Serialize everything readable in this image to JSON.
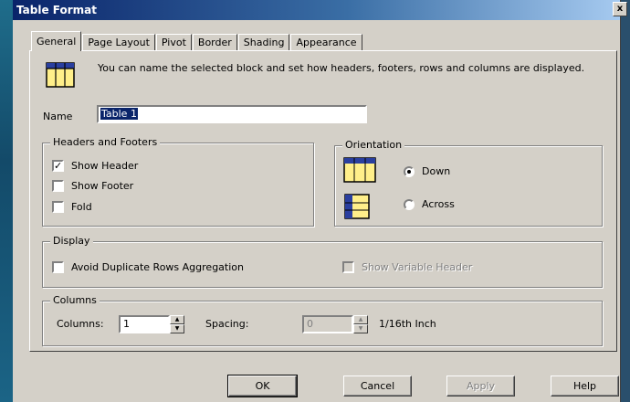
{
  "window": {
    "title": "Table Format",
    "close_glyph": "x"
  },
  "tabs": [
    "General",
    "Page Layout",
    "Pivot",
    "Border",
    "Shading",
    "Appearance"
  ],
  "active_tab": "General",
  "info": {
    "icon": "table-icon",
    "text": "You can name the selected block and set how headers, footers, rows and columns are displayed."
  },
  "name": {
    "label": "Name",
    "value": "Table 1"
  },
  "headers_footers": {
    "legend": "Headers and Footers",
    "show_header": {
      "label": "Show Header",
      "checked": true
    },
    "show_footer": {
      "label": "Show Footer",
      "checked": false
    },
    "fold": {
      "label": "Fold",
      "checked": false
    }
  },
  "orientation": {
    "legend": "Orientation",
    "down": {
      "label": "Down",
      "selected": true,
      "icon": "orientation-down-icon"
    },
    "across": {
      "label": "Across",
      "selected": false,
      "icon": "orientation-across-icon"
    }
  },
  "display": {
    "legend": "Display",
    "avoid_duplicate": {
      "label": "Avoid Duplicate Rows Aggregation",
      "checked": false
    },
    "show_variable_header": {
      "label": "Show Variable Header",
      "checked": false,
      "enabled": false
    }
  },
  "columns": {
    "legend": "Columns",
    "columns_label": "Columns:",
    "columns_value": "1",
    "spacing_label": "Spacing:",
    "spacing_value": "0",
    "spacing_unit": "1/16th Inch"
  },
  "buttons": {
    "ok": "OK",
    "cancel": "Cancel",
    "apply": "Apply",
    "help": "Help"
  },
  "colors": {
    "titlebar_start": "#0a246a",
    "face": "#d4d0c8",
    "selection": "#0a246a"
  }
}
